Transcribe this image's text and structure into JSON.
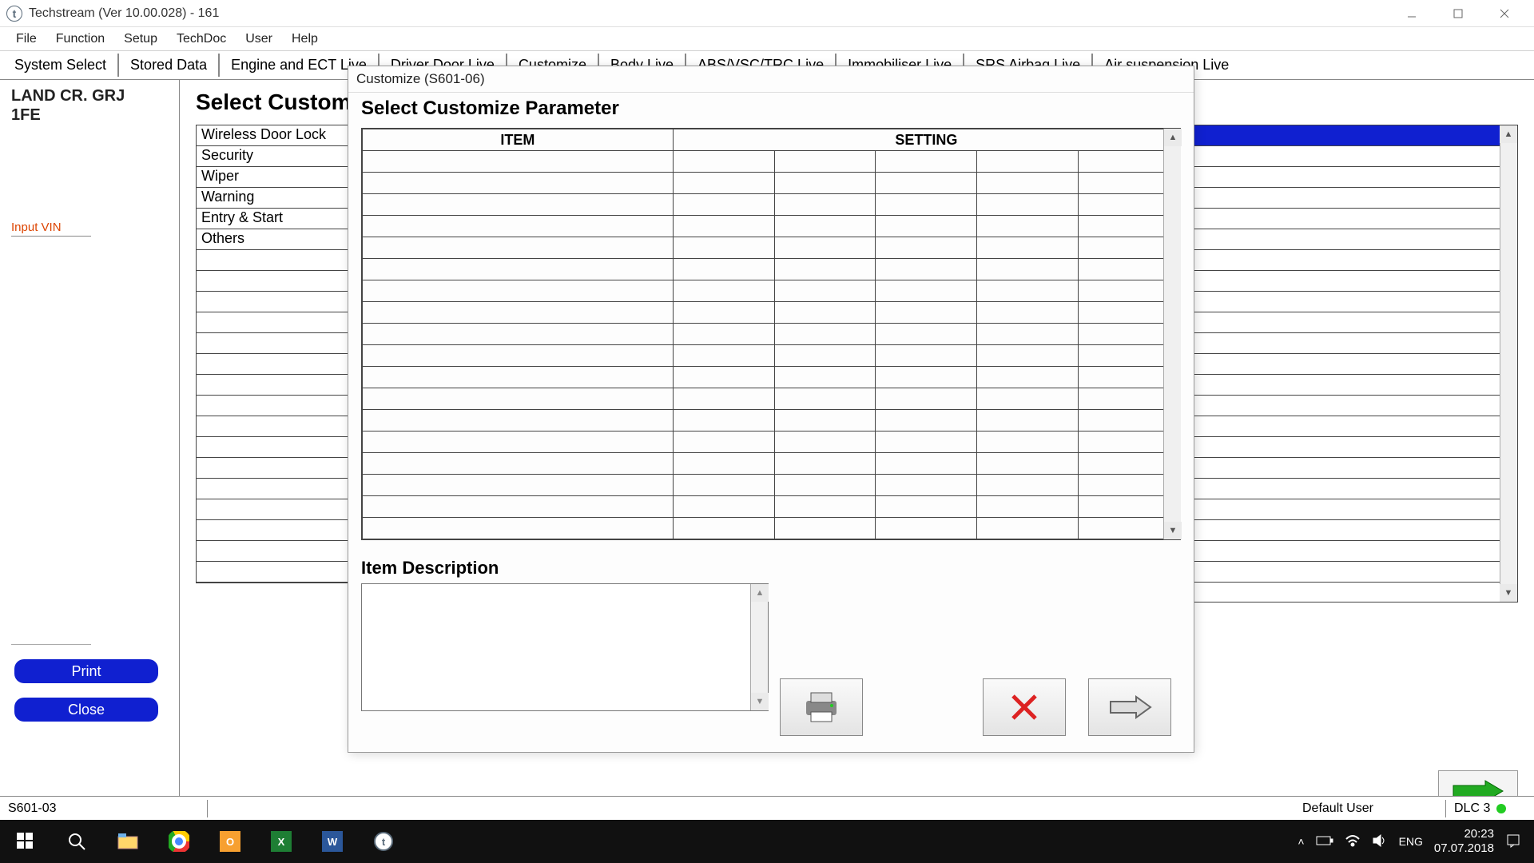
{
  "window": {
    "title": "Techstream (Ver 10.00.028) - 161"
  },
  "menu": [
    "File",
    "Function",
    "Setup",
    "TechDoc",
    "User",
    "Help"
  ],
  "tabs": [
    "System Select",
    "Stored Data",
    "Engine and ECT Live",
    "Driver Door Live",
    "Customize",
    "Body Live",
    "ABS/VSC/TRC Live",
    "Immobiliser Live",
    "SRS Airbag Live",
    "Air suspension Live"
  ],
  "sidebar": {
    "vehicle_line1": "LAND CR. GRJ",
    "vehicle_line2": "1FE",
    "input_vin": "Input VIN",
    "print": "Print",
    "close": "Close"
  },
  "content": {
    "heading": "Select Custom",
    "categories": [
      "Wireless Door Lock",
      "Security",
      "Wiper",
      "Warning",
      "Entry & Start",
      "Others"
    ]
  },
  "dialog": {
    "title": "Customize (S601-06)",
    "heading": "Select Customize Parameter",
    "col_item": "ITEM",
    "col_setting": "SETTING",
    "item_desc": "Item Description"
  },
  "statusbar": {
    "code": "S601-03",
    "user": "Default User",
    "dlc": "DLC 3"
  },
  "systray": {
    "lang": "ENG",
    "time": "20:23",
    "date": "07.07.2018"
  }
}
